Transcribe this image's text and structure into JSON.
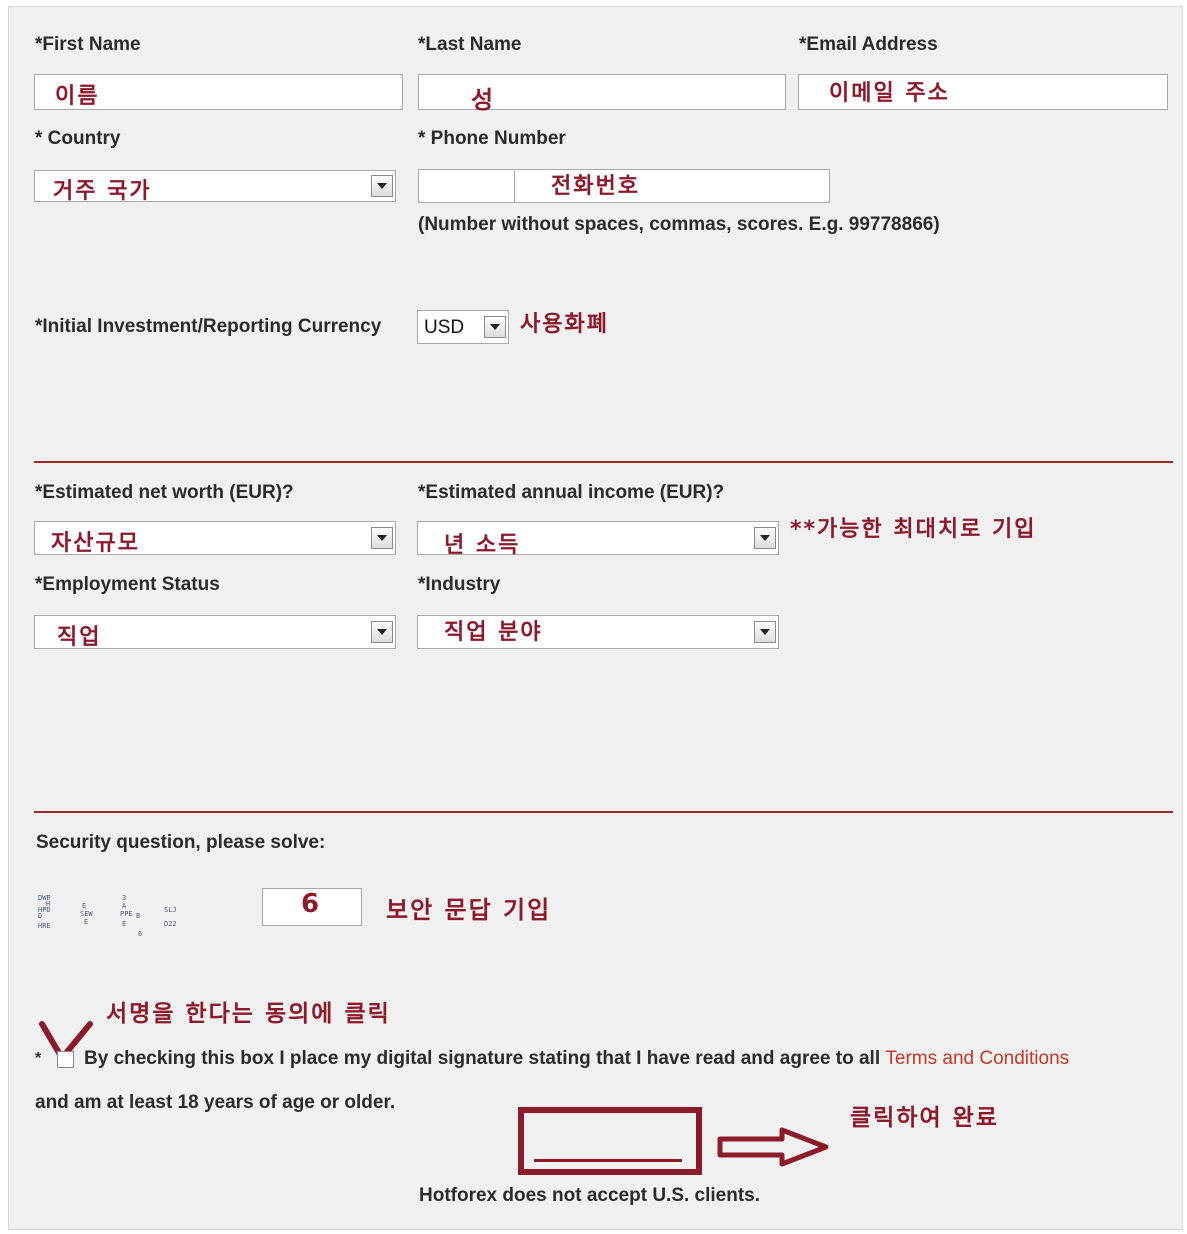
{
  "fields": {
    "first_name": {
      "label": "*First Name",
      "annotation": "이름"
    },
    "last_name": {
      "label": "*Last Name",
      "annotation": "성"
    },
    "email": {
      "label": "*Email Address",
      "annotation": "이메일 주소"
    },
    "country": {
      "label": "* Country",
      "annotation": "거주 국가"
    },
    "phone": {
      "label": "* Phone Number",
      "annotation": "전화번호",
      "hint": "(Number without spaces, commas, scores. E.g. 99778866)"
    },
    "currency": {
      "label": "*Initial Investment/Reporting Currency",
      "value": "USD",
      "annotation": "사용화폐"
    },
    "net_worth": {
      "label": "*Estimated net worth (EUR)?",
      "annotation": "자산규모"
    },
    "annual_income": {
      "label": "*Estimated annual income (EUR)?",
      "annotation": "년 소득"
    },
    "income_note": "**가능한 최대치로 기입",
    "employment": {
      "label": "*Employment Status",
      "annotation": "직업"
    },
    "industry": {
      "label": "*Industry",
      "annotation": "직업 분야"
    }
  },
  "security": {
    "label": "Security question, please solve:",
    "answer": "6",
    "annotation": "보안 문답 기입"
  },
  "agreement": {
    "asterisk": "*",
    "annotation": "서명을 한다는 동의에 클릭",
    "text": "By checking this box I place my digital signature stating that I have read and agree to all",
    "link": "Terms and Conditions",
    "text2": "and am at least 18 years of age or older."
  },
  "submit": {
    "annotation": "클릭하여 완료"
  },
  "footer": {
    "notice": "Hotforex does not accept U.S. clients."
  },
  "colors": {
    "annotation": "#8b1a2b",
    "divider": "#9b2a2a",
    "link": "#c0392b"
  }
}
